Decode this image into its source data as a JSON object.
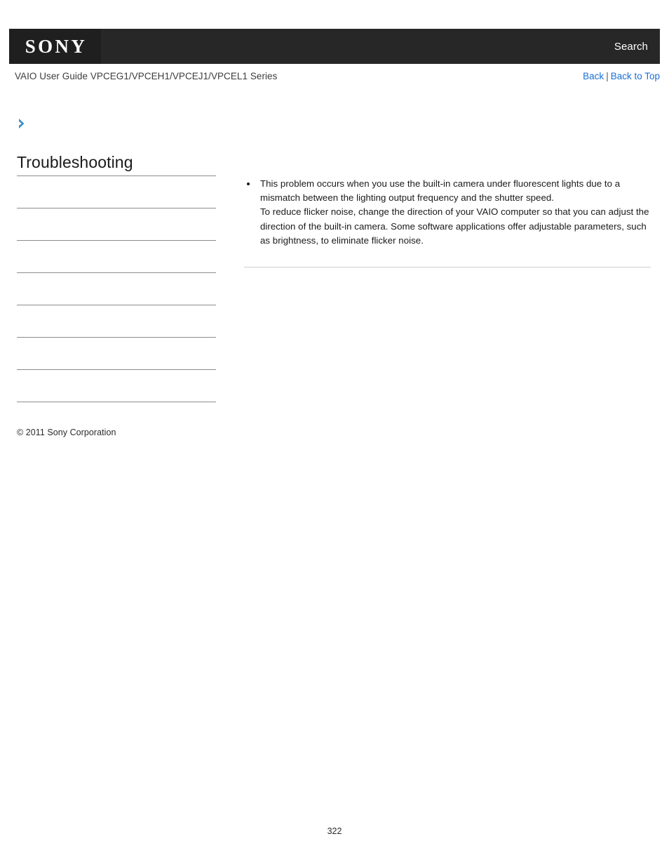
{
  "header": {
    "logo_text": "SONY",
    "search_label": "Search",
    "logo_block_color": "#1f1f1f",
    "bar_color": "#272727"
  },
  "subheader": {
    "guide_title": "VAIO User Guide VPCEG1/VPCEH1/VPCEJ1/VPCEL1 Series",
    "back_label": "Back",
    "separator": "|",
    "back_to_top_label": "Back to Top",
    "link_color": "#1a6fd4"
  },
  "sidebar": {
    "chevron_icon": "chevron-right-icon",
    "chevron_color": "#3a8fcc",
    "section_title": "Troubleshooting",
    "toc_items": [
      {
        "label": ""
      },
      {
        "label": ""
      },
      {
        "label": ""
      },
      {
        "label": ""
      },
      {
        "label": ""
      },
      {
        "label": ""
      },
      {
        "label": ""
      }
    ],
    "copyright": "© 2011 Sony Corporation"
  },
  "content": {
    "bullets": [
      "This problem occurs when you use the built-in camera under fluorescent lights due to a mismatch between the lighting output frequency and the shutter speed. To reduce flicker noise, change the direction of your VAIO computer so that you can adjust the direction of the built-in camera. Some software applications offer adjustable parameters, such as brightness, to eliminate flicker noise."
    ],
    "bullet_line_1": "This problem occurs when you use the built-in camera under fluorescent lights due to a mismatch between the lighting output frequency and the shutter speed.",
    "bullet_line_2": "To reduce flicker noise, change the direction of your VAIO computer so that you can adjust the direction of the built-in camera. Some software applications offer adjustable parameters, such as brightness, to eliminate flicker noise."
  },
  "footer": {
    "page_number": "322"
  }
}
